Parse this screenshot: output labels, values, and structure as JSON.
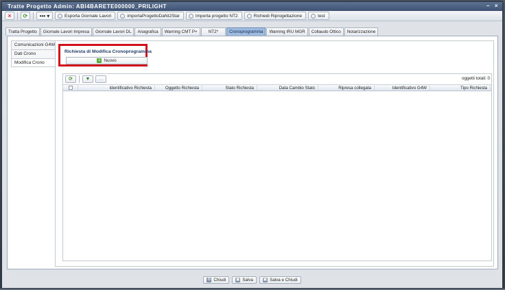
{
  "window": {
    "title": "Tratte Progetto Admin: ABI4BARETE000000_PRILIGHT"
  },
  "toolbar": {
    "close_glyph": "✕",
    "refresh_glyph": "⟳",
    "more_glyph": "•••",
    "dropdown_glyph": "▾",
    "buttons": [
      {
        "label": "Esporta Giornale Lavori"
      },
      {
        "label": "importaProgettoDaNt2Star"
      },
      {
        "label": "Importa progetto NT2"
      },
      {
        "label": "Richiedi Riprogettazione"
      },
      {
        "label": "test"
      }
    ]
  },
  "tabs": [
    {
      "label": "Tratta Progetto"
    },
    {
      "label": "Giornale Lavori Impresa"
    },
    {
      "label": "Giornale Lavori DL"
    },
    {
      "label": "Anagrafica"
    },
    {
      "label": "Warning CMT P+"
    },
    {
      "label": "NT2*"
    },
    {
      "label": "Cronoprogramma",
      "active": true
    },
    {
      "label": "Warning IRU MGR"
    },
    {
      "label": "Collaudo Ottico"
    },
    {
      "label": "Notarizzazione"
    }
  ],
  "subnav": [
    {
      "label": "Comunicazioni G4W"
    },
    {
      "label": "Dati Crono"
    },
    {
      "label": "Modifica Crono",
      "active": true
    }
  ],
  "section": {
    "title": "Richiesta di Modifica Cronoprogramma",
    "new_button": "Nuovo"
  },
  "grid": {
    "total_label": "oggetti totali: 0",
    "columns": [
      "Identificativo Richiesta",
      "Oggetto Richiesta",
      "Stato Richiesta",
      "Data Cambio Stato",
      "Ripresa collegata",
      "Identificativo G4W",
      "Tipo Richiesta"
    ]
  },
  "footer": {
    "close_label": "Chiudi",
    "save_label": "Salva",
    "save_close_label": "Salva e Chiudi"
  },
  "colors": {
    "titlebar": "#3d5273",
    "active_tab": "#9fbbe0",
    "highlight_border": "#d0111b"
  }
}
